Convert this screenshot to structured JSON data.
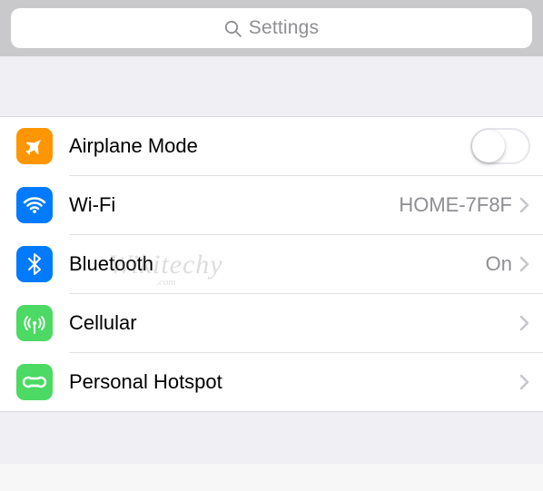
{
  "search": {
    "placeholder": "Settings"
  },
  "rows": {
    "airplane": {
      "label": "Airplane Mode",
      "toggle_on": false
    },
    "wifi": {
      "label": "Wi-Fi",
      "value": "HOME-7F8F"
    },
    "bluetooth": {
      "label": "Bluetooth",
      "value": "On"
    },
    "cellular": {
      "label": "Cellular"
    },
    "hotspot": {
      "label": "Personal Hotspot"
    }
  },
  "colors": {
    "orange": "#ff9500",
    "blue": "#007aff",
    "green": "#4cd964",
    "detail_gray": "#8e8e93"
  },
  "watermark": {
    "main": "Wikitechy",
    "sub": ".com"
  }
}
